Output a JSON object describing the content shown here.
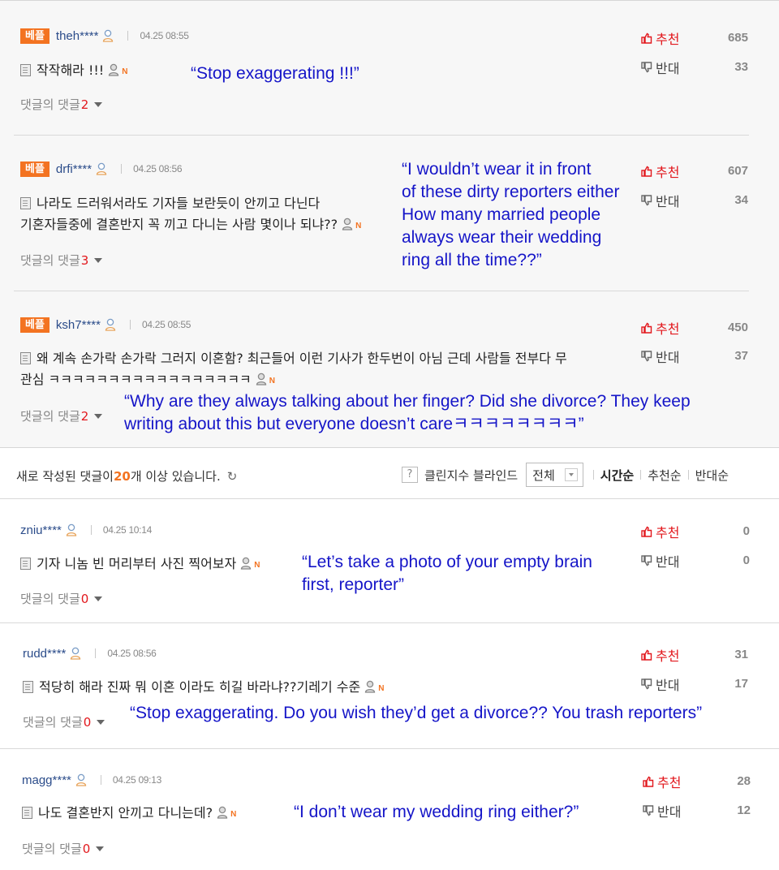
{
  "best_comments": [
    {
      "badge": "베플",
      "user": "theh****",
      "time": "04.25 08:55",
      "text_lines": [
        "작작해라 !!!"
      ],
      "reply_label": "댓글의 댓글",
      "reply_count": "2",
      "up_label": "추천",
      "up_count": "685",
      "down_label": "반대",
      "down_count": "33",
      "translation": [
        "“Stop exaggerating !!!”"
      ]
    },
    {
      "badge": "베플",
      "user": "drfi****",
      "time": "04.25 08:56",
      "text_lines": [
        "나라도 드러워서라도 기자들 보란듯이 안끼고 다닌다",
        "기혼자들중에 결혼반지 꼭 끼고 다니는 사람 몇이나 되냐??"
      ],
      "reply_label": "댓글의 댓글",
      "reply_count": "3",
      "up_label": "추천",
      "up_count": "607",
      "down_label": "반대",
      "down_count": "34",
      "translation": [
        "“I wouldn’t wear it in front",
        "of these dirty reporters either",
        "How many married people",
        "always wear their wedding",
        "ring all the time??”"
      ]
    },
    {
      "badge": "베플",
      "user": "ksh7****",
      "time": "04.25 08:55",
      "text_lines": [
        "왜 계속 손가락 손가락 그러지 이혼함? 최근들어 이런 기사가 한두번이 아님 근데 사람들 전부다 무",
        "관심 ㅋㅋㅋㅋㅋㅋㅋㅋㅋㅋㅋㅋㅋㅋㅋㅋㅋ"
      ],
      "reply_label": "댓글의 댓글",
      "reply_count": "2",
      "up_label": "추천",
      "up_count": "450",
      "down_label": "반대",
      "down_count": "37",
      "translation": [
        "“Why are they always talking about her finger? Did she divorce? They keep",
        "writing about this but everyone doesn’t careㅋㅋㅋㅋㅋㅋㅋㅋ”"
      ]
    }
  ],
  "notice": {
    "prefix": "새로 작성된 댓글이 ",
    "number": "20",
    "suffix": "개 이상 있습니다.",
    "refresh_icon": "↻"
  },
  "sort_bar": {
    "help_icon": "?",
    "clean_blind": "클린지수 블라인드",
    "filter_value": "전체",
    "sort_time": "시간순",
    "sort_recommend": "추천순",
    "sort_oppose": "반대순"
  },
  "comments": [
    {
      "user": "zniu****",
      "time": "04.25 10:14",
      "text_lines": [
        "기자 니놈 빈 머리부터 사진 찍어보자"
      ],
      "reply_label": "댓글의 댓글",
      "reply_count": "0",
      "up_label": "추천",
      "up_count": "0",
      "down_label": "반대",
      "down_count": "0",
      "translation": [
        "“Let’s take a photo of your empty brain",
        "first, reporter”"
      ]
    },
    {
      "user": "rudd****",
      "time": "04.25 08:56",
      "text_lines": [
        "적당히 해라 진짜 뭐 이혼 이라도 히길 바라냐??기레기 수준"
      ],
      "reply_label": "댓글의 댓글",
      "reply_count": "0",
      "up_label": "추천",
      "up_count": "31",
      "down_label": "반대",
      "down_count": "17",
      "translation": [
        "“Stop exaggerating. Do you wish they’d get a divorce?? You trash reporters”"
      ]
    },
    {
      "user": "magg****",
      "time": "04.25 09:13",
      "text_lines": [
        "나도 결혼반지 안끼고 다니는데?"
      ],
      "reply_label": "댓글의 댓글",
      "reply_count": "0",
      "up_label": "추천",
      "up_count": "28",
      "down_label": "반대",
      "down_count": "12",
      "translation": [
        "“I don’t wear my wedding ring either?”"
      ]
    }
  ],
  "colors": {
    "badge": "#f37321",
    "username": "#2b4c8a",
    "recommend": "#e2171c",
    "translation": "#1515c8"
  }
}
